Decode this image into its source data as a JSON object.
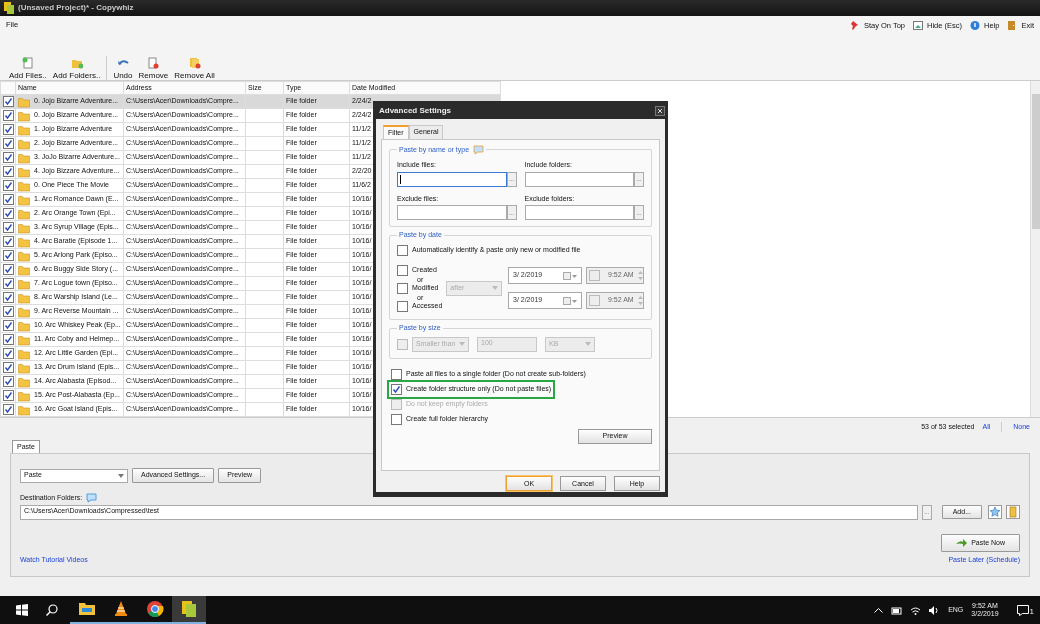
{
  "window": {
    "title": "(Unsaved Project)* - Copywhiz"
  },
  "menu": [
    "File"
  ],
  "top_actions": [
    {
      "label": "Stay On Top",
      "kind": "pin"
    },
    {
      "label": "Hide (Esc)",
      "kind": "hide"
    },
    {
      "label": "Help",
      "kind": "help"
    },
    {
      "label": "Exit",
      "kind": "exit"
    }
  ],
  "toolbar": [
    {
      "label": "Add Files..",
      "kind": "add-file"
    },
    {
      "label": "Add Folders..",
      "kind": "add-folder"
    },
    {
      "label": "Undo",
      "kind": "undo"
    },
    {
      "label": "Remove",
      "kind": "remove"
    },
    {
      "label": "Remove All",
      "kind": "remove-all"
    }
  ],
  "table": {
    "columns": [
      "Name",
      "Address",
      "Size",
      "Type",
      "Date Modified"
    ],
    "rows": [
      {
        "checked": true,
        "selected": true,
        "name": "0. Jojo Bizarre Adventure...",
        "address": "C:\\Users\\Acer\\Downloads\\Compre...",
        "type": "File folder",
        "date": "2/24/2"
      },
      {
        "checked": true,
        "selected": false,
        "name": "0. Jojo Bizarre Adventure...",
        "address": "C:\\Users\\Acer\\Downloads\\Compre...",
        "type": "File folder",
        "date": "2/24/2"
      },
      {
        "checked": true,
        "selected": false,
        "name": "1. Jojo Bizarre Adventure",
        "address": "C:\\Users\\Acer\\Downloads\\Compre...",
        "type": "File folder",
        "date": "11/1/2"
      },
      {
        "checked": true,
        "selected": false,
        "name": "2. Jojo Bizarre Adventure...",
        "address": "C:\\Users\\Acer\\Downloads\\Compre...",
        "type": "File folder",
        "date": "11/1/2"
      },
      {
        "checked": true,
        "selected": false,
        "name": "3. JoJo Bizarre Adventure...",
        "address": "C:\\Users\\Acer\\Downloads\\Compre...",
        "type": "File folder",
        "date": "11/1/2"
      },
      {
        "checked": true,
        "selected": false,
        "name": "4. Jojo Bizzare Adventure...",
        "address": "C:\\Users\\Acer\\Downloads\\Compre...",
        "type": "File folder",
        "date": "2/2/20"
      },
      {
        "checked": true,
        "selected": false,
        "name": "0. One Piece The Movie",
        "address": "C:\\Users\\Acer\\Downloads\\Compre...",
        "type": "File folder",
        "date": "11/6/2"
      },
      {
        "checked": true,
        "selected": false,
        "name": "1. Arc Romance Dawn (E...",
        "address": "C:\\Users\\Acer\\Downloads\\Compre...",
        "type": "File folder",
        "date": "10/16/"
      },
      {
        "checked": true,
        "selected": false,
        "name": "2. Arc Orange Town (Epi...",
        "address": "C:\\Users\\Acer\\Downloads\\Compre...",
        "type": "File folder",
        "date": "10/16/"
      },
      {
        "checked": true,
        "selected": false,
        "name": "3. Arc Syrup Village (Epis...",
        "address": "C:\\Users\\Acer\\Downloads\\Compre...",
        "type": "File folder",
        "date": "10/16/"
      },
      {
        "checked": true,
        "selected": false,
        "name": "4. Arc Baratie (Episode 1...",
        "address": "C:\\Users\\Acer\\Downloads\\Compre...",
        "type": "File folder",
        "date": "10/16/"
      },
      {
        "checked": true,
        "selected": false,
        "name": "5. Arc Arlong Park (Episo...",
        "address": "C:\\Users\\Acer\\Downloads\\Compre...",
        "type": "File folder",
        "date": "10/16/"
      },
      {
        "checked": true,
        "selected": false,
        "name": "6. Arc Buggy Side Story (...",
        "address": "C:\\Users\\Acer\\Downloads\\Compre...",
        "type": "File folder",
        "date": "10/16/"
      },
      {
        "checked": true,
        "selected": false,
        "name": "7. Arc Logue town (Episo...",
        "address": "C:\\Users\\Acer\\Downloads\\Compre...",
        "type": "File folder",
        "date": "10/16/"
      },
      {
        "checked": true,
        "selected": false,
        "name": "8. Arc Warship Island (Le...",
        "address": "C:\\Users\\Acer\\Downloads\\Compre...",
        "type": "File folder",
        "date": "10/16/"
      },
      {
        "checked": true,
        "selected": false,
        "name": "9. Arc Reverse Mountain ...",
        "address": "C:\\Users\\Acer\\Downloads\\Compre...",
        "type": "File folder",
        "date": "10/16/"
      },
      {
        "checked": true,
        "selected": false,
        "name": "10. Arc Whiskey Peak (Ep...",
        "address": "C:\\Users\\Acer\\Downloads\\Compre...",
        "type": "File folder",
        "date": "10/16/"
      },
      {
        "checked": true,
        "selected": false,
        "name": "11. Arc Coby and Helmep...",
        "address": "C:\\Users\\Acer\\Downloads\\Compre...",
        "type": "File folder",
        "date": "10/16/"
      },
      {
        "checked": true,
        "selected": false,
        "name": "12. Arc Little Garden (Epi...",
        "address": "C:\\Users\\Acer\\Downloads\\Compre...",
        "type": "File folder",
        "date": "10/16/"
      },
      {
        "checked": true,
        "selected": false,
        "name": "13. Arc Drum Island (Epis...",
        "address": "C:\\Users\\Acer\\Downloads\\Compre...",
        "type": "File folder",
        "date": "10/16/"
      },
      {
        "checked": true,
        "selected": false,
        "name": "14. Arc Alabasta (Episod...",
        "address": "C:\\Users\\Acer\\Downloads\\Compre...",
        "type": "File folder",
        "date": "10/16/"
      },
      {
        "checked": true,
        "selected": false,
        "name": "15. Arc Post-Alabasta (Ep...",
        "address": "C:\\Users\\Acer\\Downloads\\Compre...",
        "type": "File folder",
        "date": "10/16/"
      },
      {
        "checked": true,
        "selected": false,
        "name": "16. Arc Goat Island (Epis...",
        "address": "C:\\Users\\Acer\\Downloads\\Compre...",
        "type": "File folder",
        "date": "10/16/"
      }
    ]
  },
  "selection_status": "53 of 53 selected",
  "select_links": [
    "All",
    "None"
  ],
  "paste_panel": {
    "tabs": [
      {
        "label": "Paste",
        "selected": true
      }
    ],
    "mode": "Paste",
    "buttons": [
      "Advanced Settings...",
      "Preview"
    ],
    "destination_label": "Destination Folders:",
    "destination": "C:\\Users\\Acer\\Downloads\\Compressed\\test",
    "browse": "...",
    "add": "Add...",
    "paste_now": "Paste Now",
    "links": [
      "Watch Tutorial Videos",
      "Paste Later (Schedule)"
    ]
  },
  "dialog": {
    "title": "Advanced Settings",
    "tabs": [
      {
        "label": "Filter",
        "selected": true
      },
      {
        "label": "General",
        "selected": false
      }
    ],
    "name_group": {
      "legend": "Paste by name or type",
      "fields": [
        {
          "label": "Include files:",
          "browse": "...",
          "focused": true
        },
        {
          "label": "Include folders:",
          "browse": "...",
          "focused": false
        },
        {
          "label": "Exclude files:",
          "browse": "...",
          "focused": false
        },
        {
          "label": "Exclude folders:",
          "browse": "...",
          "focused": false
        }
      ]
    },
    "date_group": {
      "legend": "Paste by date",
      "auto": {
        "label": "Automatically identify & paste only new or modified file",
        "checked": false
      },
      "kinds": [
        {
          "label": "Created",
          "checked": false
        },
        {
          "label": "Modified",
          "checked": false
        },
        {
          "label": "Accessed",
          "checked": false
        }
      ],
      "connectors": [
        "or",
        "or"
      ],
      "comparison": "after",
      "ranges": [
        {
          "date": "3/ 2/2019",
          "time": "9:52 AM",
          "time_checked": false
        },
        {
          "date": "3/ 2/2019",
          "time": "9:52 AM",
          "time_checked": false
        }
      ]
    },
    "size_group": {
      "legend": "Paste by size",
      "checked": false,
      "comparison": "Smaller than",
      "amount": "100",
      "unit": "KB"
    },
    "options": [
      {
        "label": "Paste all files to a single folder (Do not create sub-folders)",
        "checked": false,
        "disabled": false,
        "highlighted": false
      },
      {
        "label": "Create folder structure only (Do not paste files)",
        "checked": true,
        "disabled": false,
        "highlighted": true
      },
      {
        "label": "Do not keep empty folders",
        "checked": false,
        "disabled": true,
        "highlighted": false
      },
      {
        "label": "Create full folder hierarchy",
        "checked": false,
        "disabled": false,
        "highlighted": false
      }
    ],
    "preview": "Preview",
    "buttons": [
      {
        "label": "OK",
        "kind": "default"
      },
      {
        "label": "Cancel",
        "kind": "normal"
      },
      {
        "label": "Help",
        "kind": "normal"
      }
    ]
  },
  "taskbar": {
    "apps": [
      {
        "kind": "explorer",
        "selected": false
      },
      {
        "kind": "vlc",
        "selected": false
      },
      {
        "kind": "chrome",
        "selected": false
      },
      {
        "kind": "copywhiz",
        "selected": true
      }
    ],
    "language": "ENG",
    "time": "9:52 AM",
    "date": "3/2/2019",
    "notifications": "1"
  }
}
